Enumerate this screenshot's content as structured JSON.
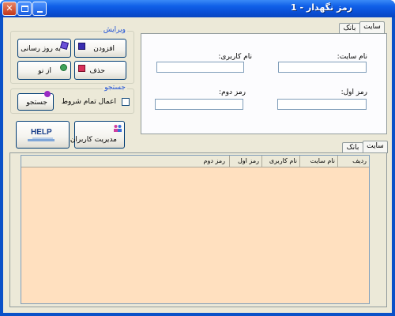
{
  "window": {
    "title": "رمز نگهدار - 1"
  },
  "edit_group": {
    "title": "ویرایش",
    "add_button": "افزودن",
    "update_button": "به روز رسانی",
    "delete_button": "حذف",
    "new_button": "از نو"
  },
  "search_group": {
    "title": "جستجو",
    "search_button": "جستجو",
    "apply_all_label": "اعمال تمام شروط"
  },
  "bottom_buttons": {
    "users_button": "مدیریت کاربران",
    "help_label": "HELP"
  },
  "top_tabs": [
    {
      "label": "سایت",
      "active": true
    },
    {
      "label": "بانک",
      "active": false
    }
  ],
  "form": {
    "site_name_label": "نام سایت:",
    "username_label": "نام کاربری:",
    "password1_label": "رمز اول:",
    "password2_label": "رمز دوم:",
    "site_name_value": "",
    "username_value": "",
    "password1_value": "",
    "password2_value": ""
  },
  "bottom_tabs": [
    {
      "label": "سایت",
      "active": true
    },
    {
      "label": "بانک",
      "active": false
    }
  ],
  "table": {
    "columns": [
      "ردیف",
      "نام سایت",
      "نام کاربری",
      "رمز اول",
      "رمز دوم"
    ],
    "rows": []
  },
  "colors": {
    "title_bar": "#0a51c8",
    "client_bg": "#ece9d8",
    "grid_bg": "#ffe0bf",
    "group_title": "#1c4fd6",
    "active_tab_accent": "#f5a623"
  }
}
